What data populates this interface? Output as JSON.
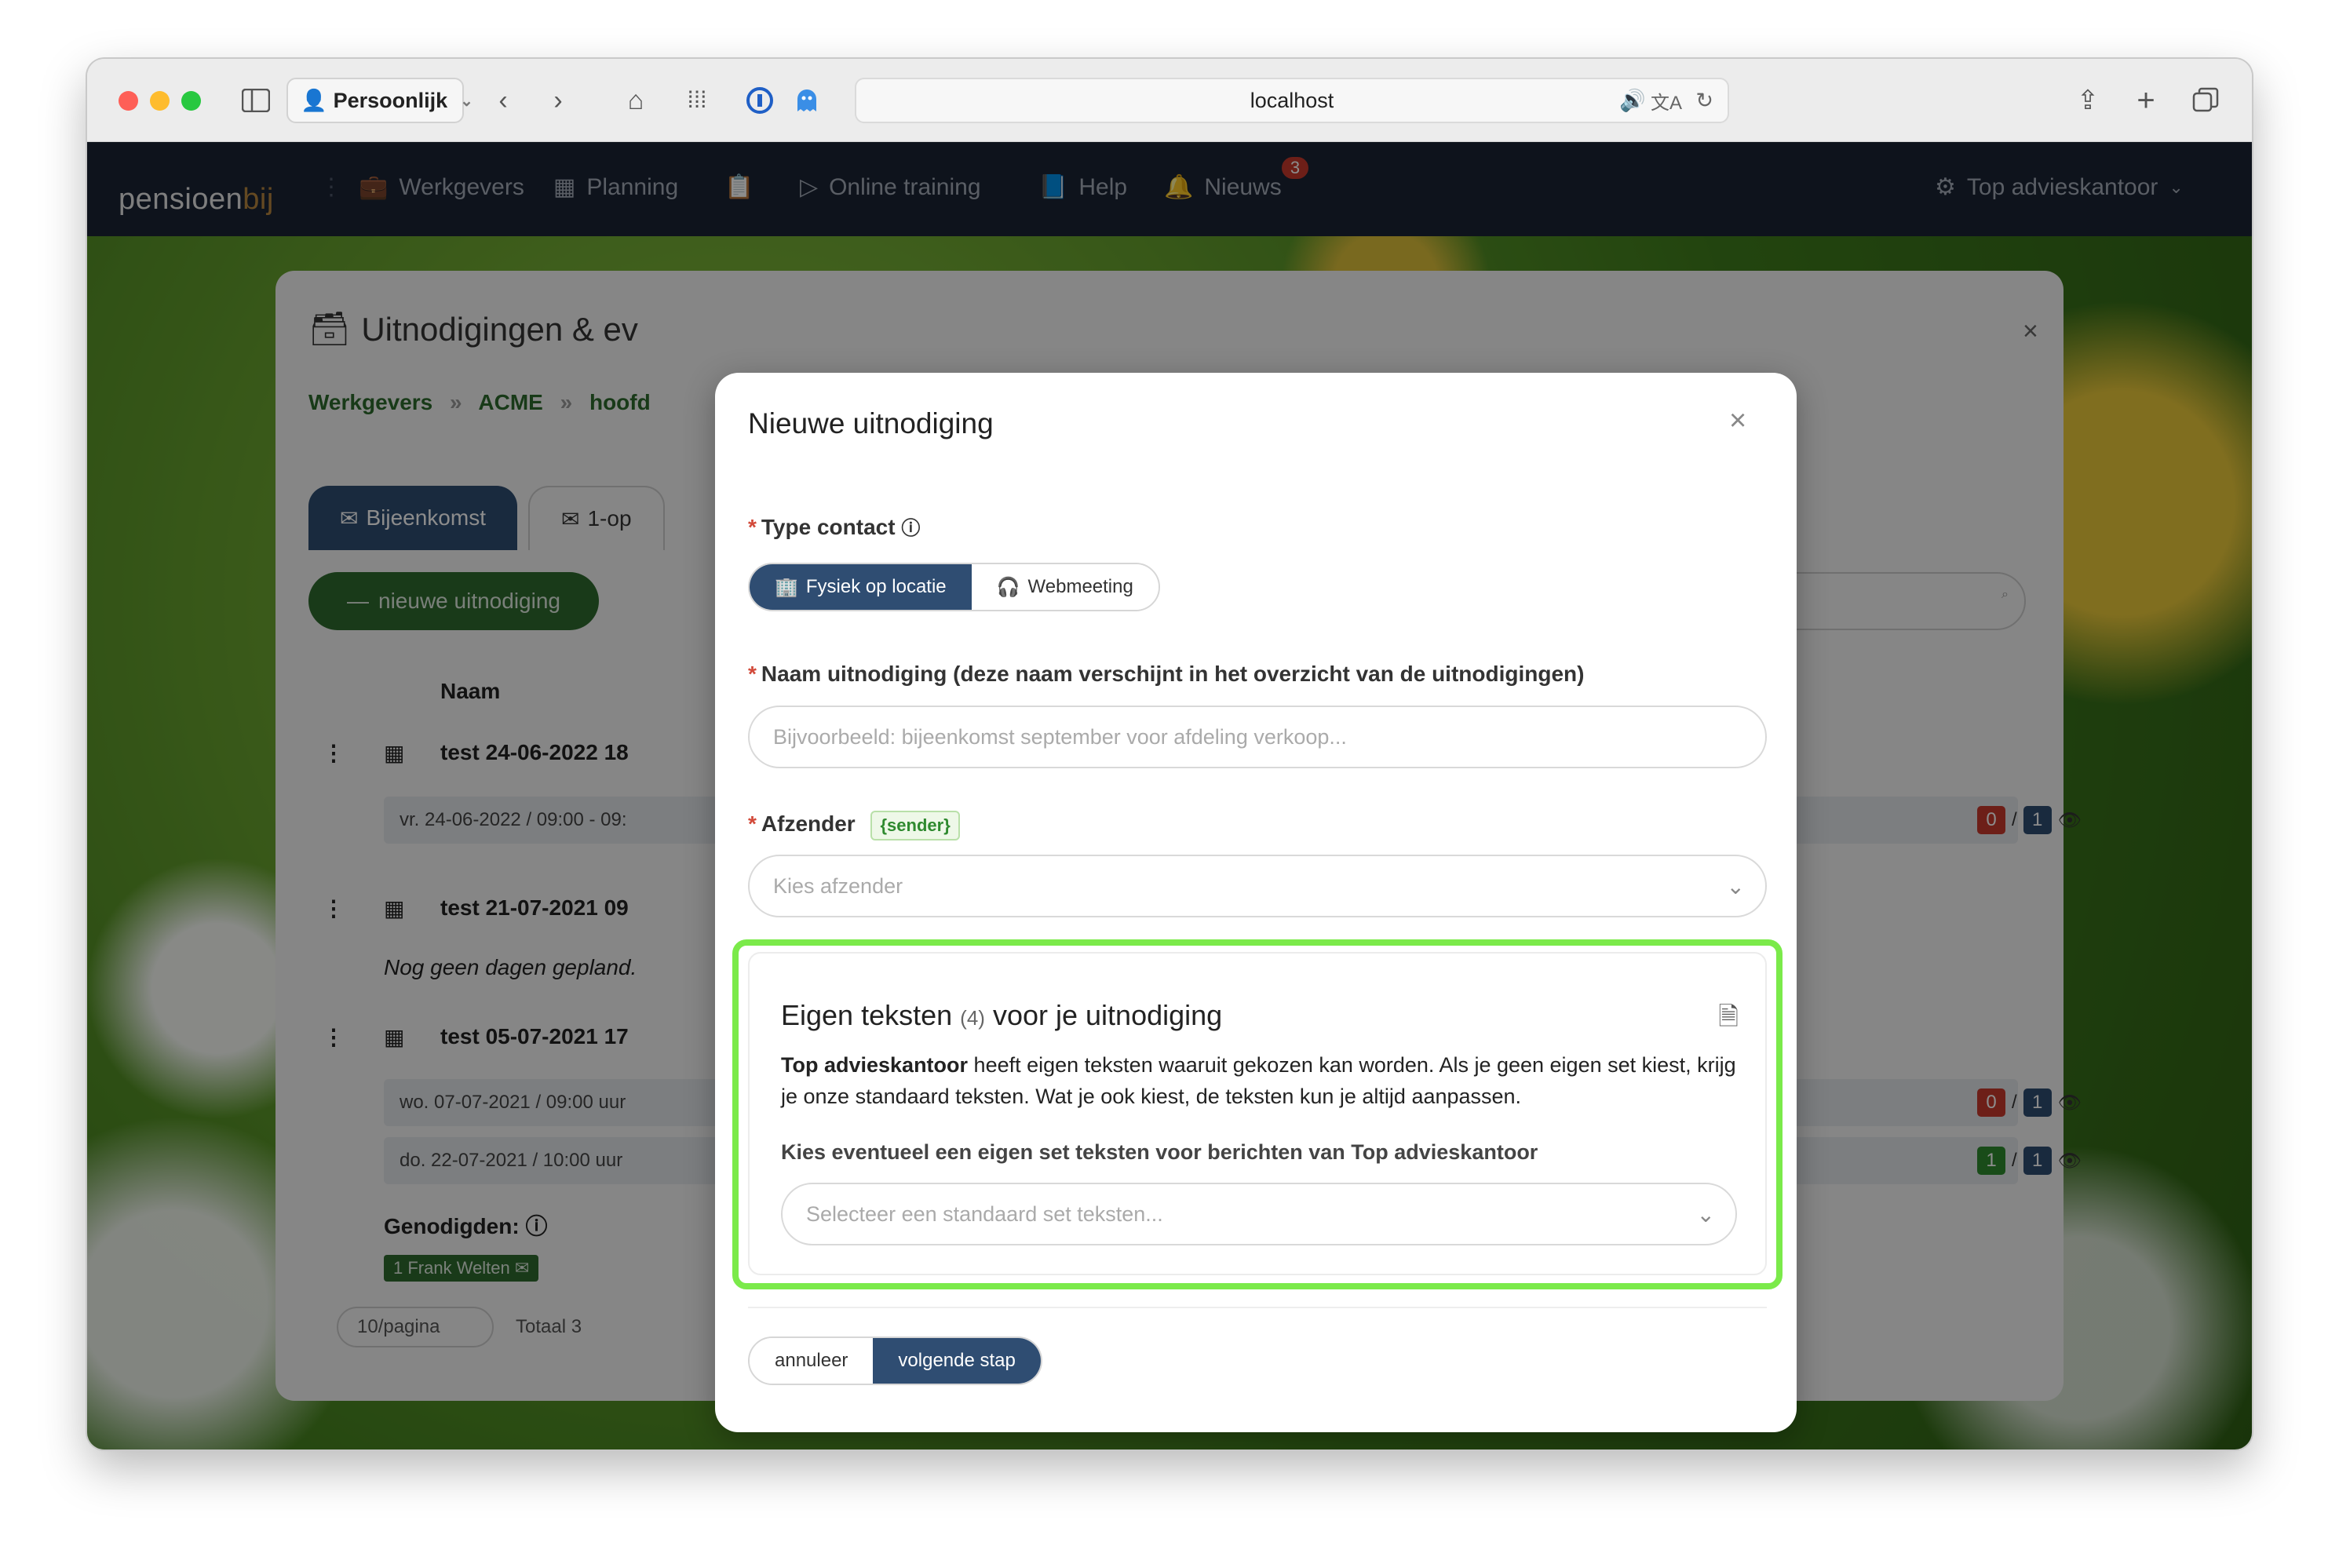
{
  "browser": {
    "profile": "Persoonlijk",
    "url": "localhost"
  },
  "nav": {
    "logo_main": "pensioen",
    "logo_accent": "bij",
    "items": [
      "Werkgevers",
      "Planning",
      "Online training",
      "Help",
      "Nieuws"
    ],
    "news_badge": "3",
    "account": "Top advieskantoor"
  },
  "page": {
    "title": "Uitnodigingen & ev",
    "breadcrumb": [
      "Werkgevers",
      "ACME",
      "hoofd"
    ],
    "tabs": [
      "Bijeenkomst",
      "1-op"
    ],
    "new_button": "nieuwe uitnodiging",
    "col_name": "Naam",
    "rows": [
      {
        "name": "test 24-06-2022 18",
        "dates": [
          "vr. 24-06-2022 / 09:00 - 09:"
        ],
        "counts": [
          {
            "a": "0",
            "b": "1"
          }
        ]
      },
      {
        "name": "test 21-07-2021 09",
        "note": "Nog geen dagen gepland."
      },
      {
        "name": "test 05-07-2021 17",
        "dates": [
          "wo. 07-07-2021 / 09:00 uur",
          "do. 22-07-2021 / 10:00 uur"
        ],
        "counts": [
          {
            "a": "0",
            "b": "1"
          },
          {
            "a": "1",
            "b": "1"
          }
        ]
      }
    ],
    "guests_label": "Genodigden:",
    "guest_tag": "1 Frank Welten",
    "per_page": "10/pagina",
    "total": "Totaal 3"
  },
  "modal": {
    "title": "Nieuwe uitnodiging",
    "type_label": "Type contact",
    "type_options": [
      "Fysiek op locatie",
      "Webmeeting"
    ],
    "name_label": "Naam uitnodiging (deze naam verschijnt in het overzicht van de uitnodigingen)",
    "name_placeholder": "Bijvoorbeeld: bijeenkomst september voor afdeling verkoop...",
    "sender_label": "Afzender",
    "sender_tag": "{sender}",
    "sender_placeholder": "Kies afzender",
    "card": {
      "title_a": "Eigen teksten",
      "title_count": "(4)",
      "title_b": "voor je uitnodiging",
      "text_bold": "Top advieskantoor",
      "text_rest": " heeft eigen teksten waaruit gekozen kan worden. Als je geen eigen set kiest, krijg je onze standaard teksten. Wat je ook kiest, de teksten kun je altijd aanpassen.",
      "question": "Kies eventueel een eigen set teksten voor berichten van Top advieskantoor",
      "select_placeholder": "Selecteer een standaard set teksten..."
    },
    "cancel": "annuleer",
    "next": "volgende stap"
  },
  "colors": {
    "primary": "#2f4d72",
    "highlight": "#7bea4a",
    "nav_bg": "#1b2434"
  }
}
